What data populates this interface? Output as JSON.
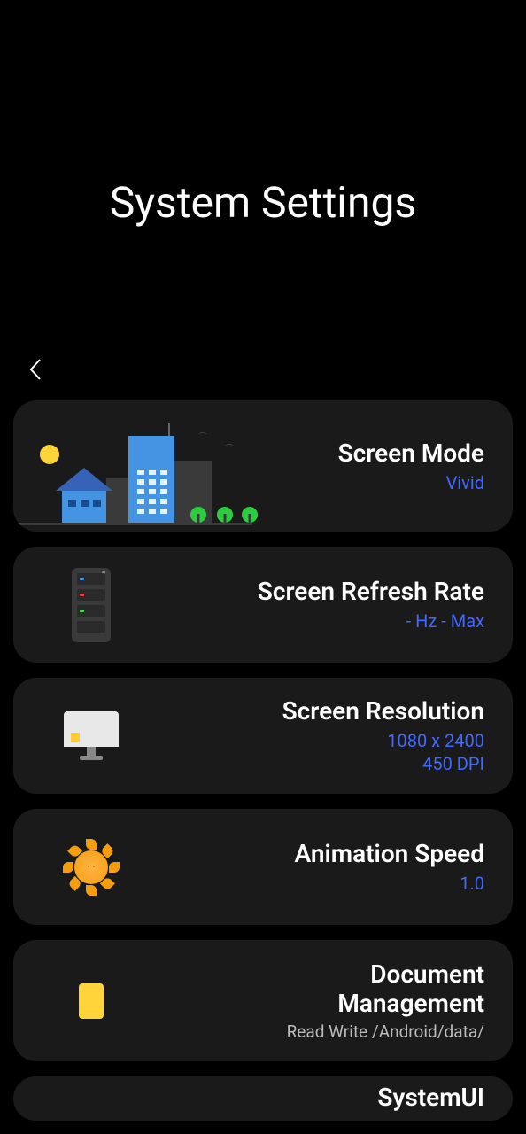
{
  "header": {
    "title": "System Settings"
  },
  "settings": {
    "screen_mode": {
      "title": "Screen Mode",
      "value": "Vivid"
    },
    "refresh_rate": {
      "title": "Screen Refresh Rate",
      "value": "- Hz - Max"
    },
    "resolution": {
      "title": "Screen Resolution",
      "value": "1080 x 2400\n450 DPI"
    },
    "animation_speed": {
      "title": "Animation Speed",
      "value": "1.0"
    },
    "document_management": {
      "title": "Document\nManagement",
      "subtitle": "Read Write /Android/data/"
    },
    "systemui": {
      "title": "SystemUI"
    }
  }
}
